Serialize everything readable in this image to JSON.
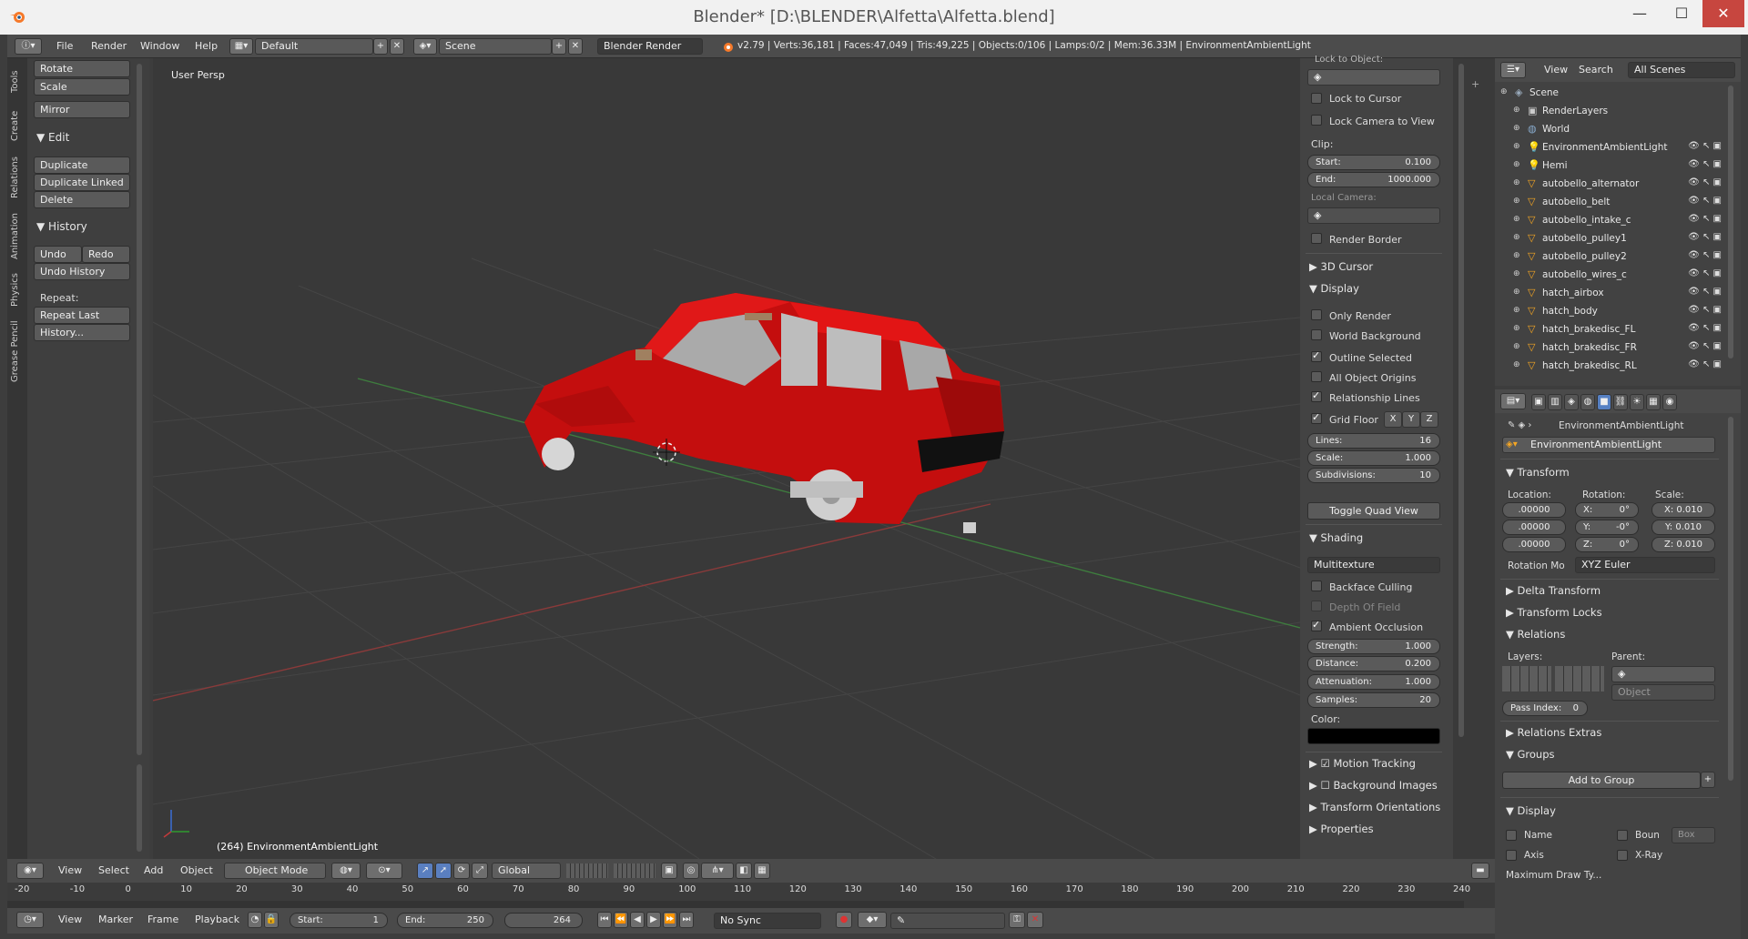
{
  "window": {
    "title": "Blender* [D:\\BLENDER\\Alfetta\\Alfetta.blend]",
    "minimize": "—",
    "maximize": "☐",
    "close": "✕"
  },
  "menubar": {
    "menus": [
      "File",
      "Render",
      "Window",
      "Help"
    ],
    "layout": "Default",
    "scene": "Scene",
    "engine": "Blender Render",
    "stats": "v2.79 | Verts:36,181 | Faces:47,049 | Tris:49,225 | Objects:0/106 | Lamps:0/2 | Mem:36.33M | EnvironmentAmbientLight"
  },
  "left_tabs": [
    "Tools",
    "Create",
    "Relations",
    "Animation",
    "Physics",
    "Grease Pencil"
  ],
  "tools": {
    "rotate": "Rotate",
    "scale": "Scale",
    "mirror": "Mirror",
    "edit_header": "Edit",
    "duplicate": "Duplicate",
    "duplicate_linked": "Duplicate Linked",
    "delete": "Delete",
    "history_header": "History",
    "undo": "Undo",
    "redo": "Redo",
    "undo_history": "Undo History",
    "repeat_label": "Repeat:",
    "repeat_last": "Repeat Last",
    "history_btn": "History..."
  },
  "viewport": {
    "label": "User Persp",
    "object_info": "(264) EnvironmentAmbientLight",
    "car_color": "#d80f0f"
  },
  "npanel": {
    "lock_to_object": "Lock to Object:",
    "lock_to_cursor": "Lock to Cursor",
    "lock_camera": "Lock Camera to View",
    "clip": "Clip:",
    "clip_start_label": "Start:",
    "clip_start": "0.100",
    "clip_end_label": "End:",
    "clip_end": "1000.000",
    "local_camera": "Local Camera:",
    "render_border": "Render Border",
    "cursor_header": "3D Cursor",
    "display_header": "Display",
    "only_render": "Only Render",
    "world_bg": "World Background",
    "outline_selected": "Outline Selected",
    "all_origins": "All Object Origins",
    "relationship_lines": "Relationship Lines",
    "grid_floor": "Grid Floor",
    "axis_x": "X",
    "axis_y": "Y",
    "axis_z": "Z",
    "lines_label": "Lines:",
    "lines": "16",
    "scale_label": "Scale:",
    "scale": "1.000",
    "subdiv_label": "Subdivisions:",
    "subdiv": "10",
    "toggle_quad": "Toggle Quad View",
    "shading_header": "Shading",
    "shading_mode": "Multitexture",
    "backface": "Backface Culling",
    "dof": "Depth Of Field",
    "ao": "Ambient Occlusion",
    "strength_label": "Strength:",
    "strength": "1.000",
    "distance_label": "Distance:",
    "distance": "0.200",
    "atten_label": "Attenuation:",
    "atten": "1.000",
    "samples_label": "Samples:",
    "samples": "20",
    "color_label": "Color:",
    "motion_tracking": "Motion Tracking",
    "bg_images": "Background Images",
    "transform_orient": "Transform Orientations",
    "properties": "Properties"
  },
  "outliner": {
    "view": "View",
    "search": "Search",
    "scenes": "All Scenes",
    "items": [
      {
        "name": "Scene",
        "indent": 0,
        "kind": "scene"
      },
      {
        "name": "RenderLayers",
        "indent": 1,
        "kind": "render"
      },
      {
        "name": "World",
        "indent": 1,
        "kind": "world"
      },
      {
        "name": "EnvironmentAmbientLight",
        "indent": 1,
        "kind": "lamp"
      },
      {
        "name": "Hemi",
        "indent": 1,
        "kind": "lamp"
      },
      {
        "name": "autobello_alternator",
        "indent": 1,
        "kind": "mesh"
      },
      {
        "name": "autobello_belt",
        "indent": 1,
        "kind": "mesh"
      },
      {
        "name": "autobello_intake_c",
        "indent": 1,
        "kind": "mesh"
      },
      {
        "name": "autobello_pulley1",
        "indent": 1,
        "kind": "mesh"
      },
      {
        "name": "autobello_pulley2",
        "indent": 1,
        "kind": "mesh"
      },
      {
        "name": "autobello_wires_c",
        "indent": 1,
        "kind": "mesh"
      },
      {
        "name": "hatch_airbox",
        "indent": 1,
        "kind": "mesh"
      },
      {
        "name": "hatch_body",
        "indent": 1,
        "kind": "mesh"
      },
      {
        "name": "hatch_brakedisc_FL",
        "indent": 1,
        "kind": "mesh"
      },
      {
        "name": "hatch_brakedisc_FR",
        "indent": 1,
        "kind": "mesh"
      },
      {
        "name": "hatch_brakedisc_RL",
        "indent": 1,
        "kind": "mesh"
      }
    ]
  },
  "properties": {
    "breadcrumb": "EnvironmentAmbientLight",
    "object_name": "EnvironmentAmbientLight",
    "transform_header": "Transform",
    "location_label": "Location:",
    "rotation_label": "Rotation:",
    "scale_label": "Scale:",
    "loc": [
      ".00000",
      ".00000",
      ".00000"
    ],
    "rot": [
      {
        "axis": "X:",
        "val": "0°"
      },
      {
        "axis": "Y:",
        "val": "-0°"
      },
      {
        "axis": "Z:",
        "val": "0°"
      }
    ],
    "scl": [
      "X: 0.010",
      "Y: 0.010",
      "Z: 0.010"
    ],
    "rotation_mode_label": "Rotation Mo",
    "rotation_mode": "XYZ Euler",
    "delta_transform": "Delta Transform",
    "transform_locks": "Transform Locks",
    "relations_header": "Relations",
    "layers_label": "Layers:",
    "parent_label": "Parent:",
    "parent_type": "Object",
    "pass_index_label": "Pass Index:",
    "pass_index": "0",
    "relations_extras": "Relations Extras",
    "groups_header": "Groups",
    "add_to_group": "Add to Group",
    "display_header": "Display",
    "name_label": "Name",
    "axis_label": "Axis",
    "bounds_label": "Boun",
    "bounds_type": "Box",
    "xray_label": "X-Ray",
    "max_draw": "Maximum Draw Ty..."
  },
  "view3d_header": {
    "view": "View",
    "select": "Select",
    "add": "Add",
    "object": "Object",
    "mode": "Object Mode",
    "orientation": "Global"
  },
  "timeline": {
    "ticks": [
      "-20",
      "-10",
      "0",
      "10",
      "20",
      "30",
      "40",
      "50",
      "60",
      "70",
      "80",
      "90",
      "100",
      "110",
      "120",
      "130",
      "140",
      "150",
      "160",
      "170",
      "180",
      "190",
      "200",
      "210",
      "220",
      "230",
      "240"
    ],
    "view": "View",
    "marker": "Marker",
    "frame": "Frame",
    "playback": "Playback",
    "start_label": "Start:",
    "start": "1",
    "end_label": "End:",
    "end": "250",
    "current": "264",
    "sync": "No Sync"
  }
}
